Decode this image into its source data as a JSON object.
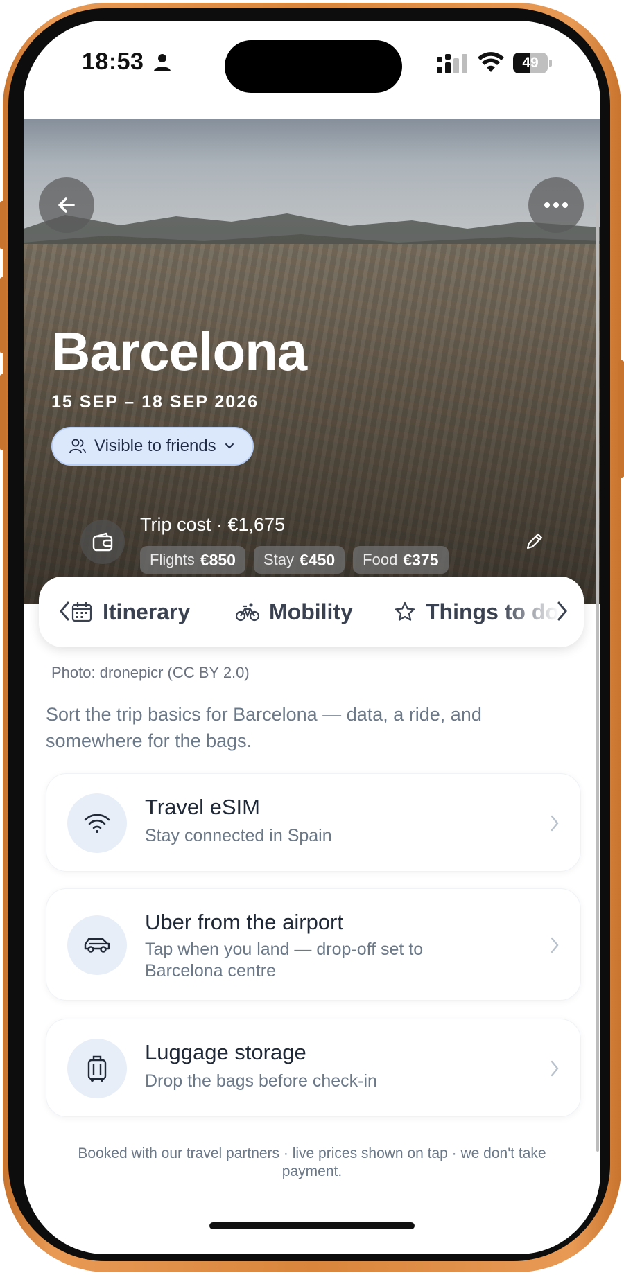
{
  "status_bar": {
    "time": "18:53",
    "battery_level": "49",
    "battery_fraction": 0.49
  },
  "hero": {
    "city": "Barcelona",
    "dates": "15 SEP – 18 SEP 2026",
    "visibility_label": "Visible to friends",
    "trip_cost_label": "Trip cost · €1,675",
    "chips": [
      {
        "label": "Flights",
        "value": "€850"
      },
      {
        "label": "Stay",
        "value": "€450"
      },
      {
        "label": "Food",
        "value": "€375"
      }
    ]
  },
  "tabs": [
    {
      "label": "Itinerary",
      "icon": "calendar-icon"
    },
    {
      "label": "Mobility",
      "icon": "bicycle-icon"
    },
    {
      "label": "Things to do",
      "icon": "star-icon"
    }
  ],
  "content": {
    "photo_credit": "Photo: dronepicr (CC BY 2.0)",
    "intro": "Sort the trip basics for Barcelona — data, a ride, and somewhere for the bags.",
    "cards": [
      {
        "title": "Travel eSIM",
        "subtitle": "Stay connected in Spain",
        "icon": "wifi-icon"
      },
      {
        "title": "Uber from the airport",
        "subtitle": "Tap when you land — drop-off set to Barcelona centre",
        "icon": "car-icon"
      },
      {
        "title": "Luggage storage",
        "subtitle": "Drop the bags before check-in",
        "icon": "luggage-icon"
      }
    ],
    "footnote": "Booked with our travel partners · live prices shown on tap · we don't take payment."
  },
  "colors": {
    "frame": "#d9853c",
    "pill_bg": "#dbe7fb",
    "card_icon_bg": "#e8eef7",
    "muted_text": "#6b7888"
  }
}
